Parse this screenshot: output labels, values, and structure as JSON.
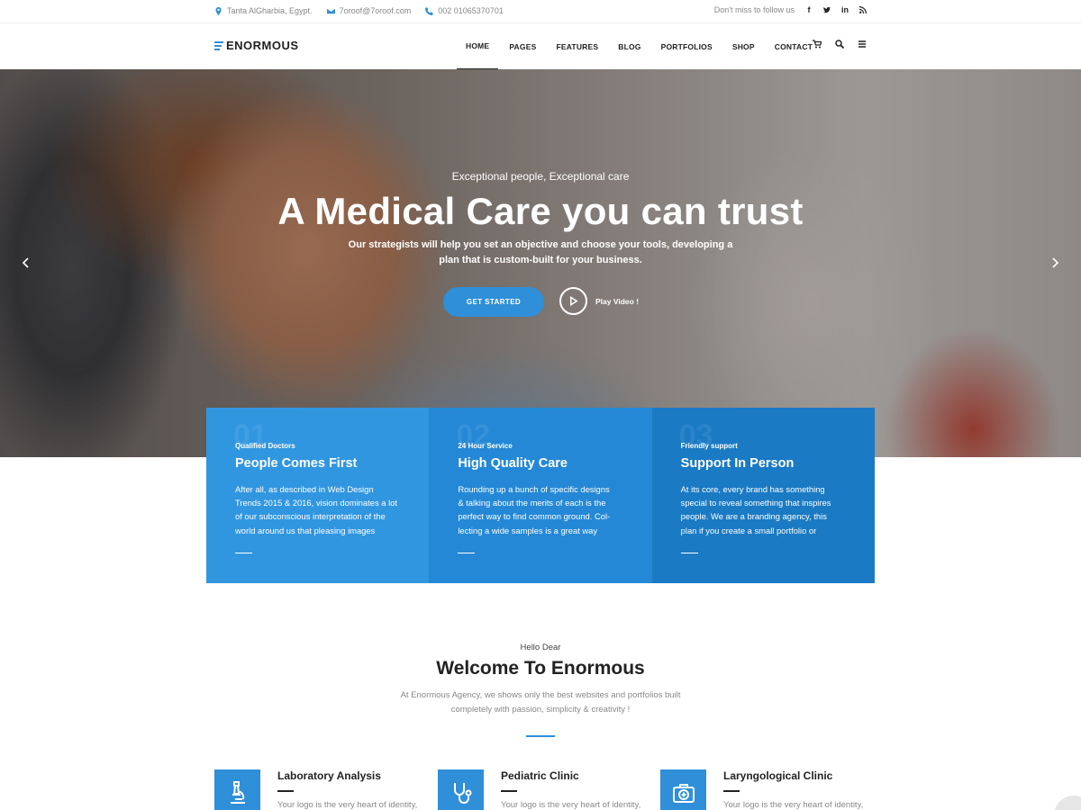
{
  "topbar": {
    "address": "Tanta AlGharbia, Egypt.",
    "email": "7oroof@7oroof.com",
    "phone": "002 01065370701",
    "follow_label": "Don't miss to follow us",
    "social": [
      "facebook-icon",
      "twitter-icon",
      "linkedin-icon",
      "rss-icon"
    ]
  },
  "nav": {
    "logo": "ENORMOUS",
    "items": [
      "HOME",
      "PAGES",
      "FEATURES",
      "BLOG",
      "PORTFOLIOS",
      "SHOP",
      "CONTACT"
    ],
    "active": "HOME"
  },
  "hero": {
    "kicker": "Exceptional people, Exceptional care",
    "title": "A Medical Care you can trust",
    "subtitle_line1": "Our strategists will help you set an objective and choose your tools, developing a",
    "subtitle_line2": "plan that is custom-built for your business.",
    "cta": "GET STARTED",
    "play": "Play Video !"
  },
  "features": [
    {
      "number": "01",
      "small": "Qualified Doctors",
      "title": "People Comes First",
      "lines": [
        "After all, as described in Web Design",
        "Trends 2015 & 2016, vision dominates a lot",
        "of our subconscious interpretation of the",
        "world around us that pleasing images"
      ],
      "color": "#3196e0"
    },
    {
      "number": "02",
      "small": "24 Hour Service",
      "title": "High Quality Care",
      "lines": [
        "Rounding up a bunch of specific designs",
        "& talking about the merits of each is the",
        "perfect way to find common ground. Col-",
        "lecting a wide samples is a great way"
      ],
      "color": "#2488d6"
    },
    {
      "number": "03",
      "small": "Friendly support",
      "title": "Support In Person",
      "lines": [
        "At its core, every brand has something",
        "special to reveal something that inspires",
        "people. We are a branding agency, this",
        "plan if you create a small portfolio or"
      ],
      "color": "#1a7ac4"
    }
  ],
  "welcome": {
    "hello": "Hello Dear",
    "title": "Welcome To Enormous",
    "desc_line1": "At Enormous Agency, we shows only the best websites and portfolios built",
    "desc_line2": "completely with passion, simplicity & creativity !"
  },
  "services": [
    {
      "title": "Laboratory Analysis",
      "desc": "Your logo is the very heart of identity,",
      "icon": "microscope-icon"
    },
    {
      "title": "Pediatric Clinic",
      "desc": "Your logo is the very heart of identity,",
      "icon": "stethoscope-icon"
    },
    {
      "title": "Laryngological Clinic",
      "desc": "Your logo is the very heart of identity,",
      "icon": "first-aid-kit-icon"
    }
  ]
}
